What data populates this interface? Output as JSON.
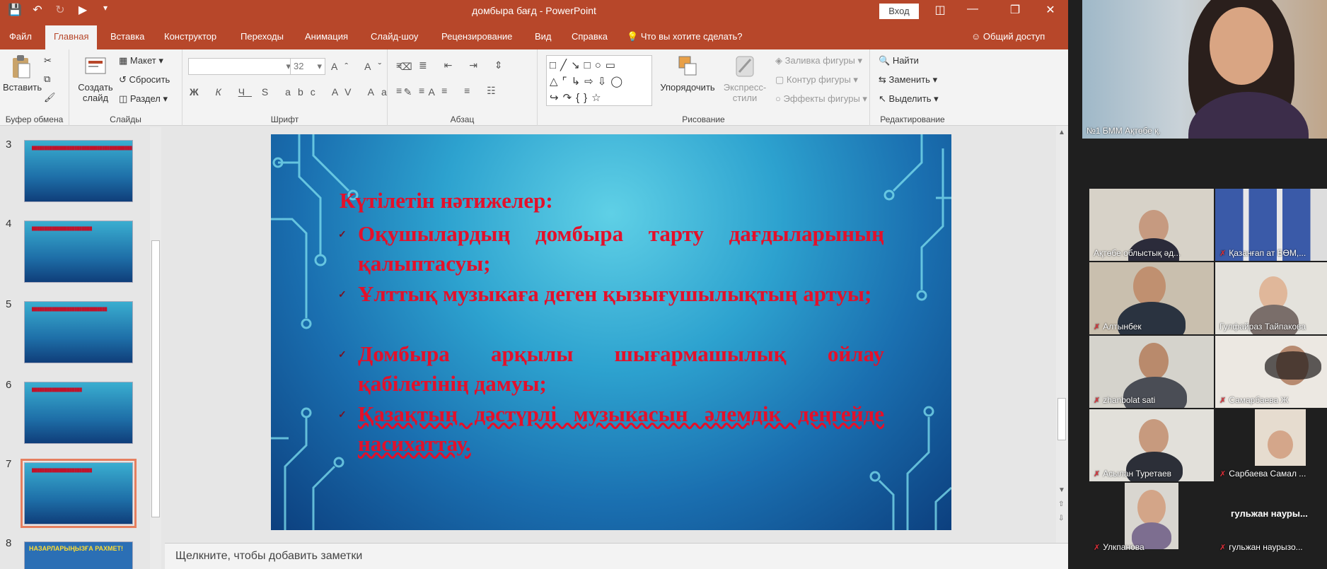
{
  "titlebar": {
    "doc_title": "домбыра бағд  -  PowerPoint",
    "signin": "Вход"
  },
  "tabs": [
    {
      "label": "Файл"
    },
    {
      "label": "Главная"
    },
    {
      "label": "Вставка"
    },
    {
      "label": "Конструктор"
    },
    {
      "label": "Переходы"
    },
    {
      "label": "Анимация"
    },
    {
      "label": "Слайд-шоу"
    },
    {
      "label": "Рецензирование"
    },
    {
      "label": "Вид"
    },
    {
      "label": "Справка"
    }
  ],
  "tell_me": "Что вы хотите сделать?",
  "share": "Общий доступ",
  "ribbon": {
    "clipboard": {
      "paste": "Вставить",
      "label": "Буфер обмена"
    },
    "slides": {
      "new_slide_line1": "Создать",
      "new_slide_line2": "слайд",
      "layout": "Макет",
      "reset": "Сбросить",
      "section": "Раздел",
      "label": "Слайды"
    },
    "font": {
      "size": "32",
      "label": "Шрифт"
    },
    "paragraph": {
      "label": "Абзац"
    },
    "drawing": {
      "arrange": "Упорядочить",
      "quick_styles_line1": "Экспресс-",
      "quick_styles_line2": "стили",
      "fill": "Заливка фигуры",
      "outline": "Контур фигуры",
      "effects": "Эффекты фигуры",
      "label": "Рисование"
    },
    "editing": {
      "find": "Найти",
      "replace": "Заменить",
      "select": "Выделить",
      "label": "Редактирование"
    }
  },
  "thumbnails": [
    {
      "num": "3"
    },
    {
      "num": "4"
    },
    {
      "num": "5"
    },
    {
      "num": "6"
    },
    {
      "num": "7"
    },
    {
      "num": "8",
      "banner": "НАЗАРЛАРЫҢЫЗҒА РАХМЕТ!"
    }
  ],
  "slide": {
    "title": "Күтілетін нәтижелер:",
    "bullets": [
      "Оқушылардың домбыра тарту дағдыларының қалыптасуы;",
      "Ұлттық музыкаға деген қызығушылықтың артуы;",
      "Домбыра арқылы шығармашылық ойлау қабілетінің дамуы;",
      "Қазақтың дәстүрлі музыкасын әлемдік деңгейде насихаттау."
    ]
  },
  "notes_placeholder": "Щелкните, чтобы добавить заметки",
  "conference": {
    "speaker_name": "№1 БММ  Ақтөбе қ.",
    "participants": [
      {
        "name": "Ақтөбе облыстық әд..."
      },
      {
        "name": "Қазанғап ат БӨМ,..."
      },
      {
        "name": "Алтынбек"
      },
      {
        "name": "Гулфайраз Тайпакова"
      },
      {
        "name": "zhanbolat sati"
      },
      {
        "name": "Самарбаева Ж"
      },
      {
        "name": "Асылан Туретаев"
      },
      {
        "name": "Сарбаева Самал ..."
      },
      {
        "name": "Улкпанова"
      },
      {
        "name": "гульжан наурызо..."
      }
    ],
    "no_video_name": "гульжан науры..."
  }
}
